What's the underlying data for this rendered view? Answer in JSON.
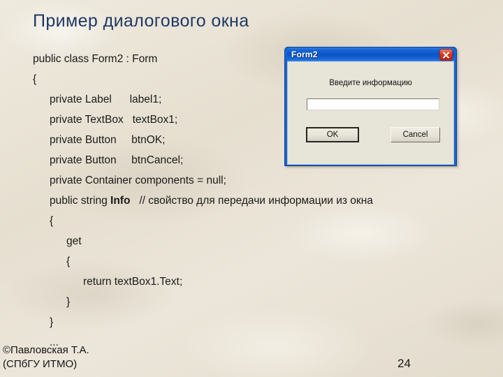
{
  "slide": {
    "title": "Пример диалогового окна",
    "number": "24",
    "credit": "©Павловская Т.А.\n(СПбГУ ИТМО)",
    "background_color": "#e9e3d6",
    "title_color": "#1f3864"
  },
  "code": {
    "lines": [
      {
        "text": "public class Form2 : Form",
        "indent": 0
      },
      {
        "text": "{",
        "indent": 0
      },
      {
        "text": "private Label      label1;",
        "indent": 1
      },
      {
        "text": "private TextBox   textBox1;",
        "indent": 1
      },
      {
        "text": "private Button     btnOK;",
        "indent": 1
      },
      {
        "text": "private Button     btnCancel;",
        "indent": 1
      },
      {
        "text": "private Container components = null;",
        "indent": 1
      },
      {
        "text": "public string <b>Info</b>   // свойство для передачи информации из окна",
        "indent": 1,
        "html": true
      },
      {
        "text": "{",
        "indent": 1
      },
      {
        "text": "get",
        "indent": 2
      },
      {
        "text": "{",
        "indent": 2
      },
      {
        "text": "return textBox1.Text;",
        "indent": 3
      },
      {
        "text": "}",
        "indent": 2
      },
      {
        "text": "}",
        "indent": 1
      },
      {
        "text": "...",
        "indent": 1
      }
    ]
  },
  "dialog": {
    "title": "Form2",
    "close_icon": "close-x-icon",
    "prompt_label": "Введите информацию",
    "input_value": "",
    "input_placeholder": "",
    "ok_label": "OK",
    "cancel_label": "Cancel",
    "titlebar_color": "#0c52c4",
    "close_button_color": "#d93a23",
    "client_color": "#e7e4d8"
  }
}
